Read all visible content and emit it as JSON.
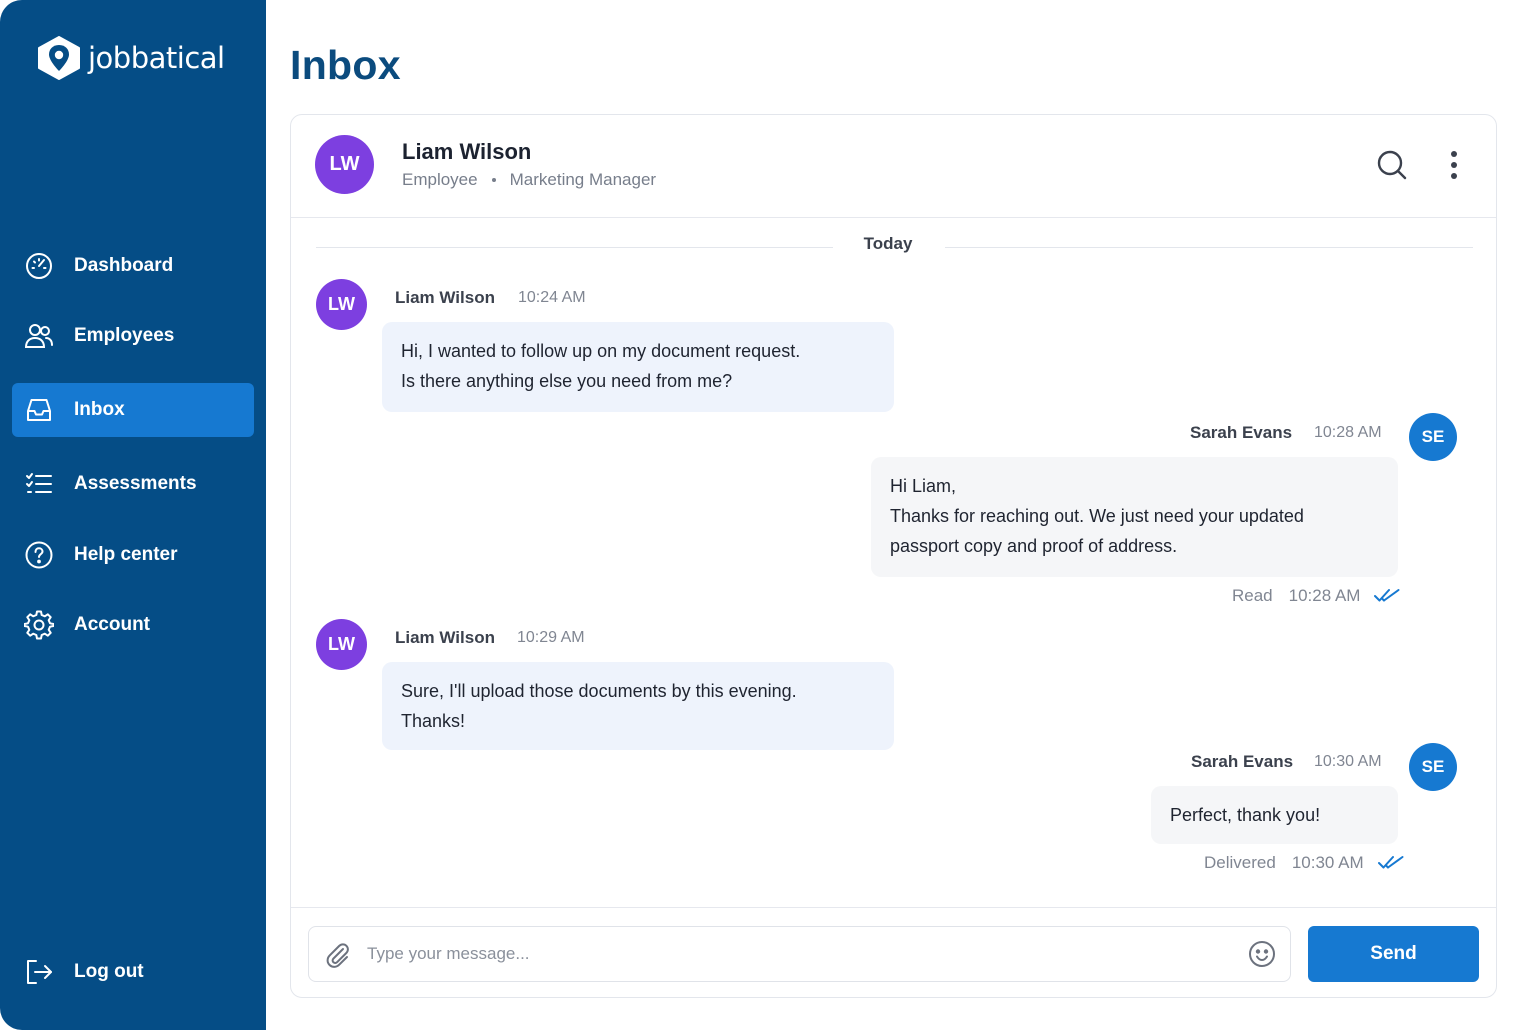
{
  "brand": {
    "name": "jobbatical"
  },
  "colors": {
    "sidebar": "#054d86",
    "accent": "#1679d1",
    "avatar_lw": "#7d3fe0",
    "title": "#0b4b7e"
  },
  "sidebar": {
    "items": [
      {
        "label": "Dashboard",
        "icon": "gauge-icon"
      },
      {
        "label": "Employees",
        "icon": "users-icon"
      },
      {
        "label": "Inbox",
        "icon": "inbox-icon",
        "active": true
      },
      {
        "label": "Assessments",
        "icon": "checklist-icon"
      },
      {
        "label": "Help center",
        "icon": "help-icon"
      },
      {
        "label": "Account",
        "icon": "gear-icon"
      }
    ],
    "logout": {
      "label": "Log out",
      "icon": "logout-icon"
    }
  },
  "page": {
    "title": "Inbox"
  },
  "chat": {
    "contact": {
      "initials": "LW",
      "name": "Liam Wilson",
      "role": "Employee",
      "title": "Marketing Manager"
    },
    "day_divider": "Today",
    "messages": [
      {
        "from": "Liam Wilson",
        "initials": "LW",
        "time": "10:24 AM",
        "direction": "in",
        "lines": [
          "Hi, I wanted to follow up on my document request.",
          "Is there anything else you need from me?"
        ]
      },
      {
        "from": "Sarah Evans",
        "initials": "SE",
        "time": "10:28 AM",
        "direction": "out",
        "lines": [
          "Hi Liam,",
          "Thanks for reaching out. We just need your updated",
          "passport copy and proof of address."
        ],
        "status": "Read",
        "status_time": "10:28 AM"
      },
      {
        "from": "Liam Wilson",
        "initials": "LW",
        "time": "10:29 AM",
        "direction": "in",
        "lines": [
          "Sure, I'll upload those documents by this evening.",
          "Thanks!"
        ]
      },
      {
        "from": "Sarah Evans",
        "initials": "SE",
        "time": "10:30 AM",
        "direction": "out",
        "lines": [
          "Perfect, thank you!"
        ],
        "status": "Delivered",
        "status_time": "10:30 AM"
      }
    ],
    "composer": {
      "placeholder": "Type your message...",
      "value": "",
      "send_label": "Send"
    }
  }
}
